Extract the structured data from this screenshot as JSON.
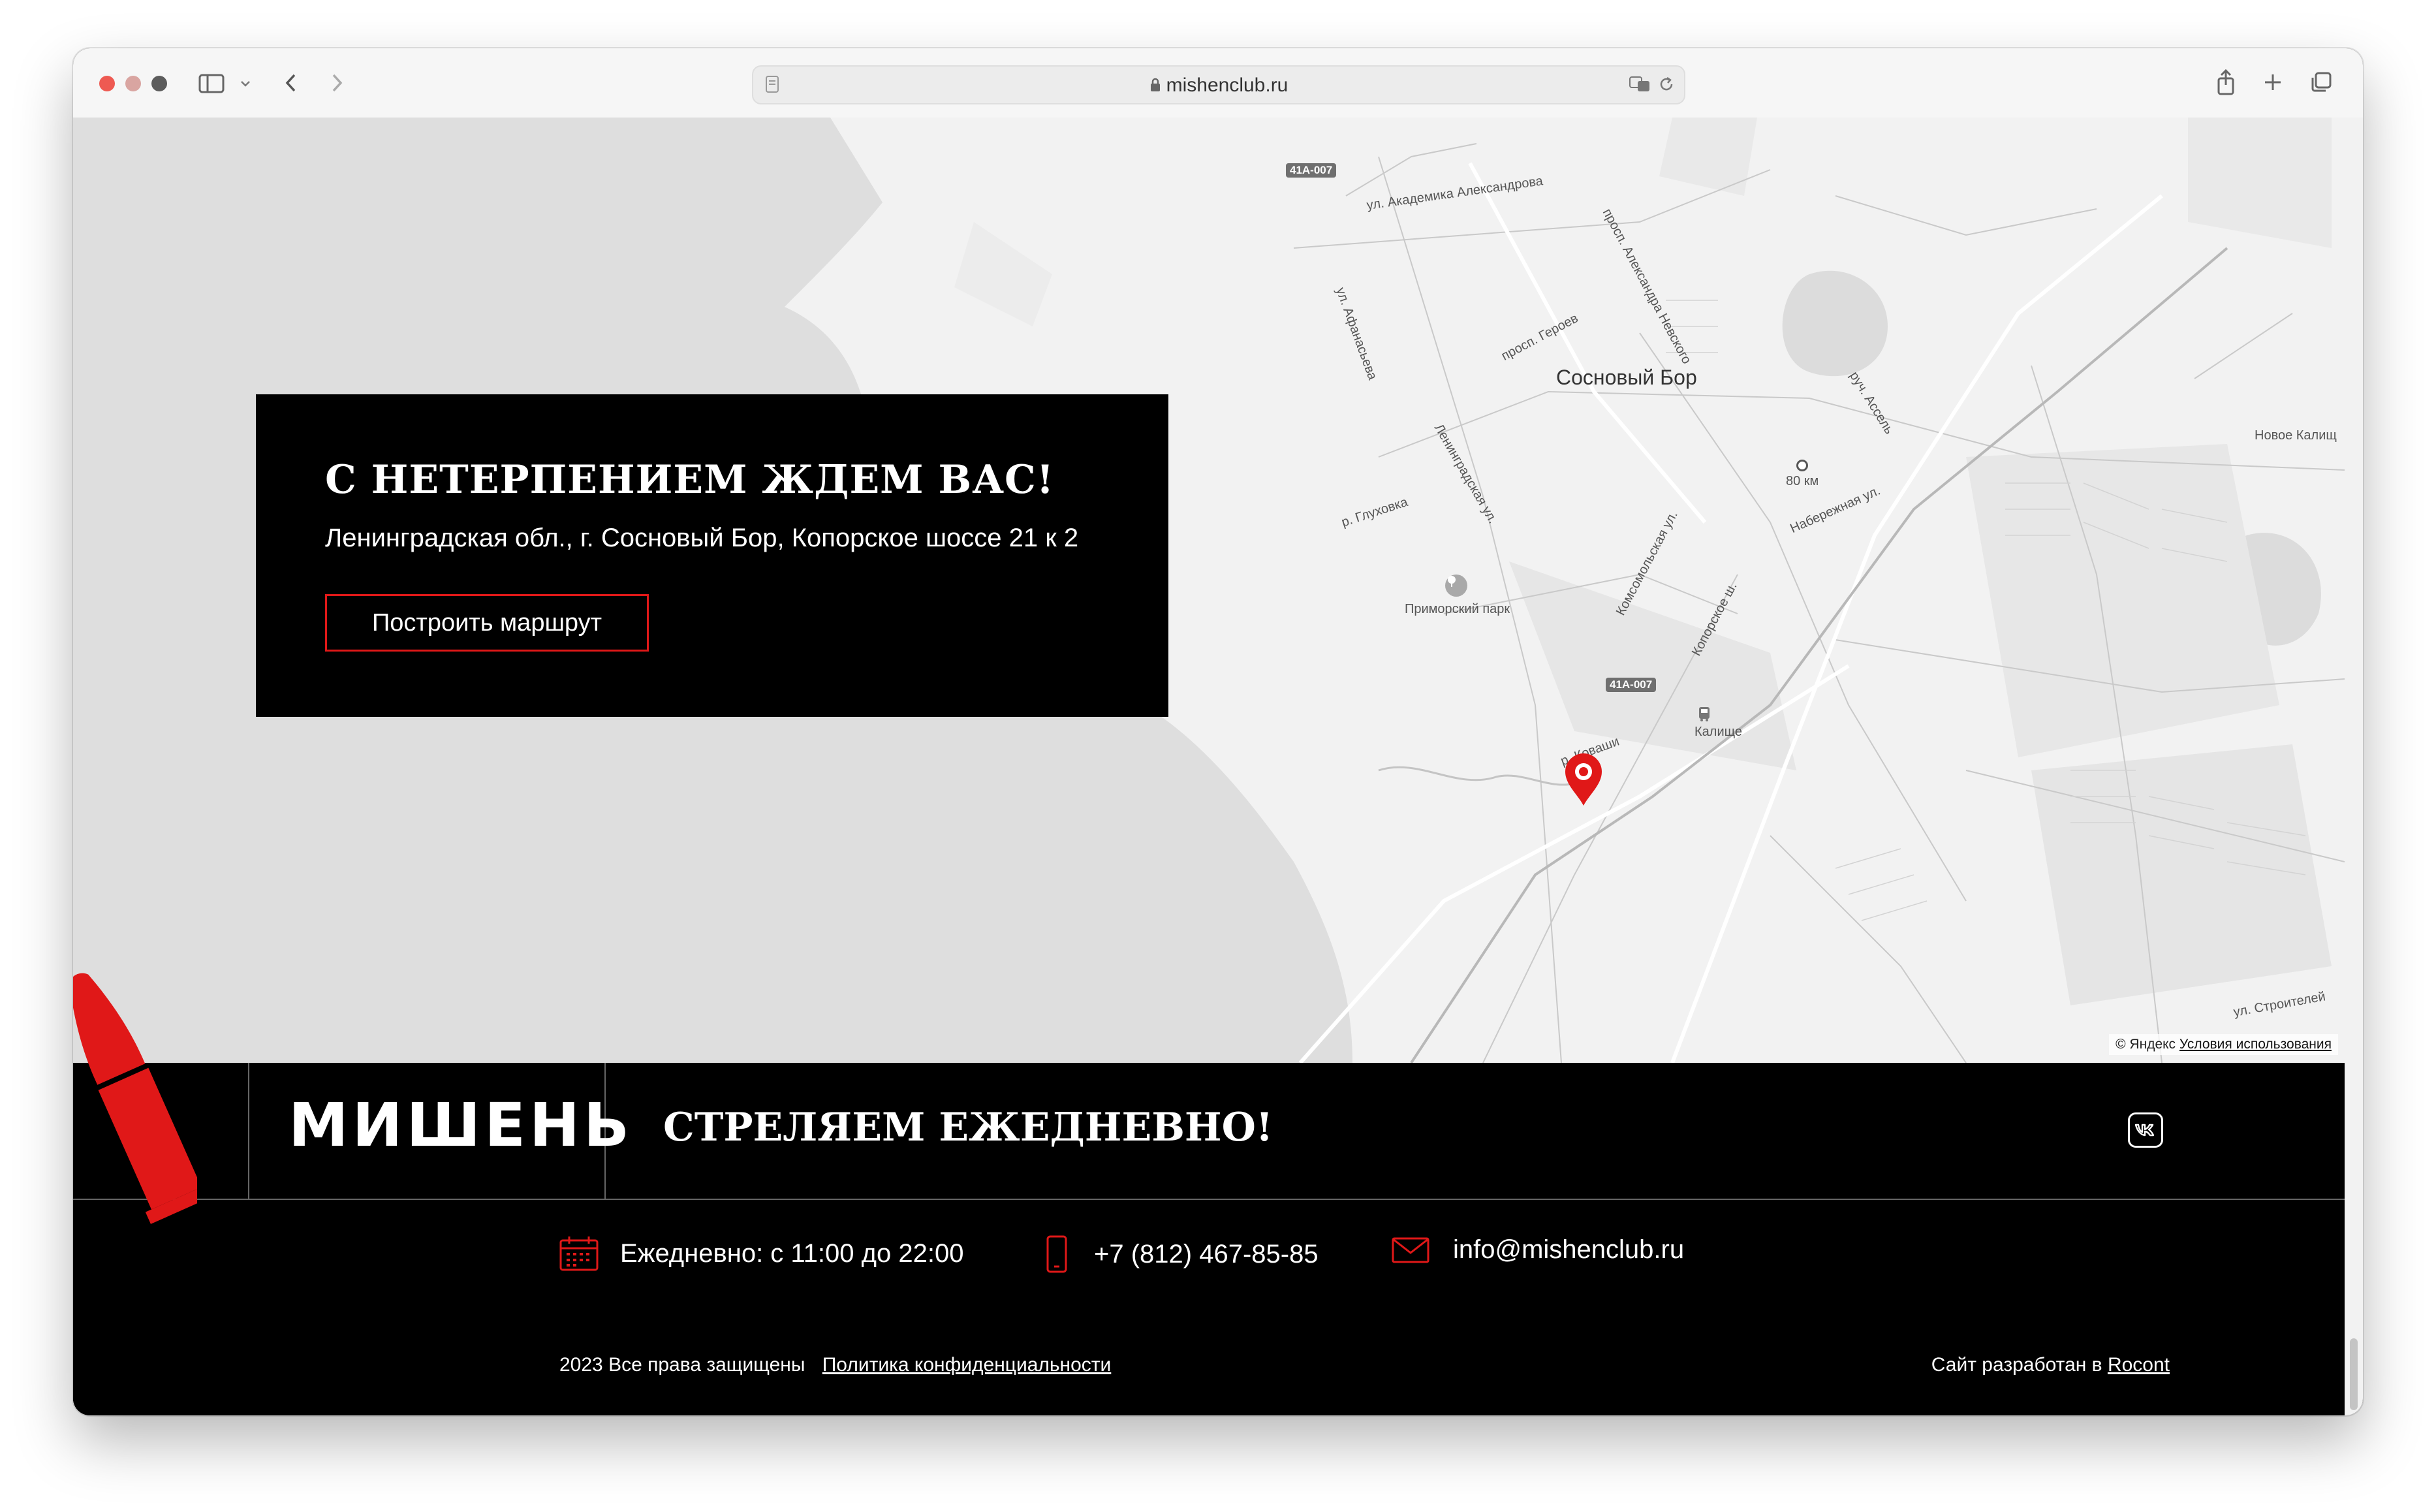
{
  "browser": {
    "url": "mishenclub.ru",
    "colors": {
      "close": "#ee5a52",
      "minimize": "#d9a5a1",
      "zoom": "#5c5c5c"
    }
  },
  "map": {
    "labels": {
      "city": "Сосновый Бор",
      "novoe_kalishche": "Новое Калищ",
      "km80": "80 км",
      "park": "Приморский парк",
      "kalishche": "Калище",
      "akad": "ул. Академика Александрова",
      "nevsky": "просп. Александра Невского",
      "afanaseva": "ул. Афанасьева",
      "geroev": "просп. Героев",
      "leningradskaya": "Ленинградская ул.",
      "glukhovka": "р. Глуховка",
      "komsomolskaya": "Комсомольская ул.",
      "naberezhnaya": "Набережная ул.",
      "koporskoe": "Копорское ш.",
      "ruch": "руч. Ассель",
      "stroitelei": "ул. Строителей",
      "kovashi": "р. Коваши"
    },
    "road_badge_1": "41А-007",
    "road_badge_2": "41А-007",
    "attribution": "© Яндекс",
    "attribution_link": "Условия использования",
    "marker_color": "#e01818"
  },
  "card": {
    "title": "С НЕТЕРПЕНИЕМ ЖДЕМ ВАС!",
    "address": "Ленинградская обл., г. Сосновый Бор, Копорское шоссе 21 к 2",
    "route_button": "Построить маршрут"
  },
  "footer": {
    "logo": "МИШЕНЬ",
    "slogan": "СТРЕЛЯЕМ ЕЖЕДНЕВНО!",
    "social_icon": "vk-icon",
    "hours": "Ежедневно: с 11:00 до 22:00",
    "phone": "+7 (812) 467-85-85",
    "email": "info@mishenclub.ru",
    "copyright": "2023 Все права защищены",
    "privacy_link": "Политика конфиденциальности",
    "credit_prefix": "Сайт разработан в",
    "credit_link": "Rocont",
    "accent_color": "#e01818"
  }
}
